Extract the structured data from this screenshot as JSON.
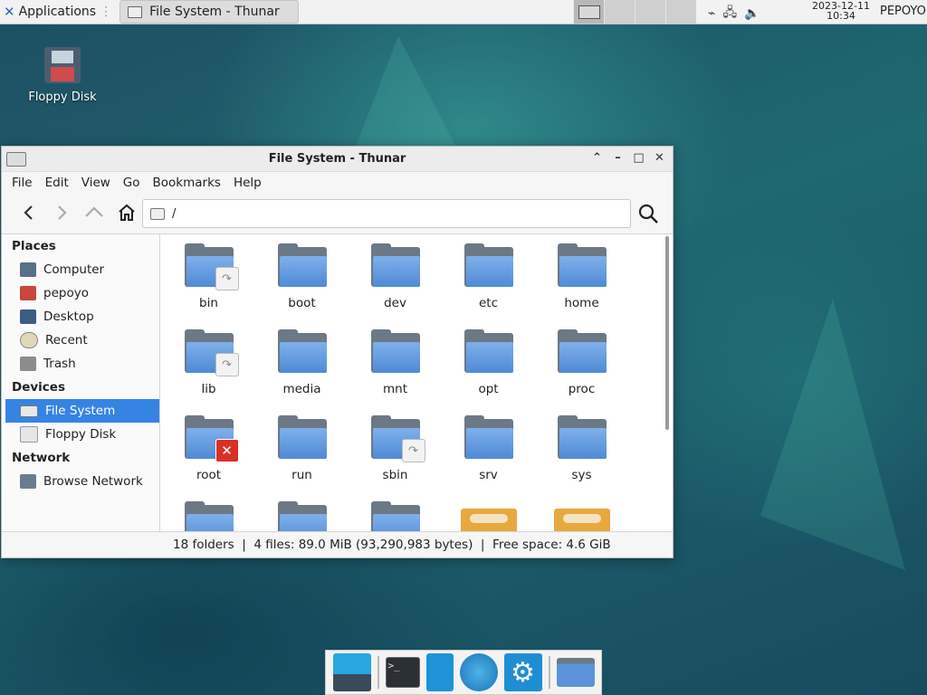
{
  "panel": {
    "applications_label": "Applications",
    "task_title": "File System - Thunar",
    "clock_date": "2023-12-11",
    "clock_time": "10:34",
    "user": "PEPOYO"
  },
  "desktop": {
    "icons": [
      {
        "label": "Floppy Disk",
        "icon": "floppy-icon"
      }
    ]
  },
  "window": {
    "title": "File System - Thunar",
    "menu": [
      "File",
      "Edit",
      "View",
      "Go",
      "Bookmarks",
      "Help"
    ],
    "location": "/",
    "sidebar": {
      "places_header": "Places",
      "places": [
        "Computer",
        "pepoyo",
        "Desktop",
        "Recent",
        "Trash"
      ],
      "devices_header": "Devices",
      "devices": [
        "File System",
        "Floppy Disk"
      ],
      "network_header": "Network",
      "network": [
        "Browse Network"
      ]
    },
    "files": [
      {
        "name": "bin",
        "badge": "link"
      },
      {
        "name": "boot",
        "badge": ""
      },
      {
        "name": "dev",
        "badge": ""
      },
      {
        "name": "etc",
        "badge": ""
      },
      {
        "name": "home",
        "badge": ""
      },
      {
        "name": "lib",
        "badge": "link"
      },
      {
        "name": "media",
        "badge": ""
      },
      {
        "name": "mnt",
        "badge": ""
      },
      {
        "name": "opt",
        "badge": ""
      },
      {
        "name": "proc",
        "badge": ""
      },
      {
        "name": "root",
        "badge": "no-access"
      },
      {
        "name": "run",
        "badge": ""
      },
      {
        "name": "sbin",
        "badge": "link"
      },
      {
        "name": "srv",
        "badge": ""
      },
      {
        "name": "sys",
        "badge": ""
      }
    ],
    "status": "18 folders  |  4 files: 89.0 MiB (93,290,983 bytes)  |  Free space: 4.6 GiB"
  },
  "colors": {
    "selection": "#3584e4",
    "folder": "#5b93db"
  }
}
